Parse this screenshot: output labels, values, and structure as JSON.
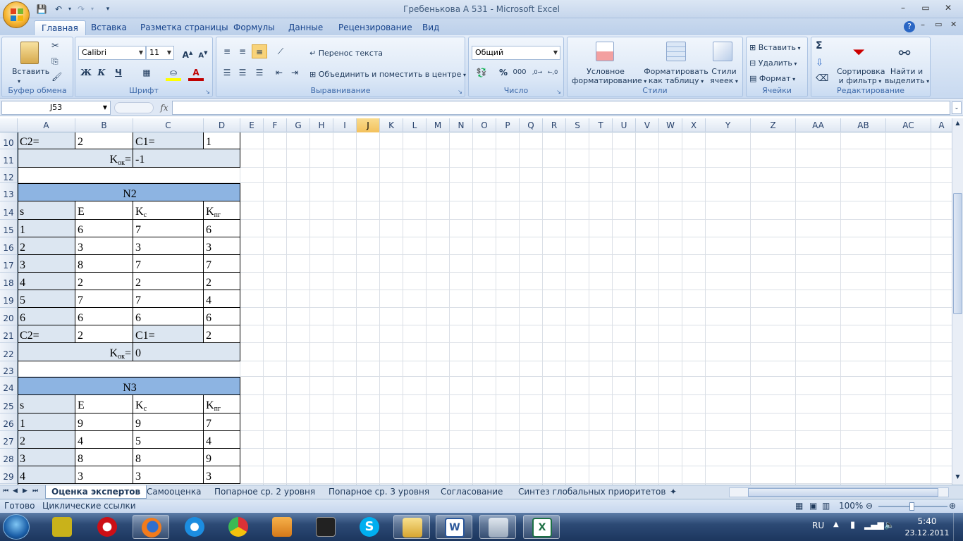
{
  "window": {
    "title": "Гребенькова А 531 - Microsoft Excel"
  },
  "ribbon": {
    "tabs": [
      "Главная",
      "Вставка",
      "Разметка страницы",
      "Формулы",
      "Данные",
      "Рецензирование",
      "Вид"
    ],
    "active_tab": "Главная",
    "clipboard": {
      "paste": "Вставить",
      "label": "Буфер обмена"
    },
    "font": {
      "name": "Calibri",
      "size": "11",
      "bold": "Ж",
      "italic": "К",
      "underline": "Ч",
      "label": "Шрифт"
    },
    "alignment": {
      "wrap": "Перенос текста",
      "merge": "Объединить и поместить в центре",
      "label": "Выравнивание"
    },
    "number": {
      "format": "Общий",
      "label": "Число",
      "percent": "%",
      "thousands": "000"
    },
    "styles": {
      "conditional1": "Условное",
      "conditional2": "форматирование",
      "table1": "Форматировать",
      "table2": "как таблицу",
      "cell1": "Стили",
      "cell2": "ячеек",
      "label": "Стили"
    },
    "cells": {
      "insert": "Вставить",
      "delete": "Удалить",
      "format": "Формат",
      "label": "Ячейки"
    },
    "editing": {
      "sigma": "Σ",
      "sort1": "Сортировка",
      "sort2": "и фильтр",
      "find1": "Найти и",
      "find2": "выделить",
      "label": "Редактирование"
    }
  },
  "formula_bar": {
    "name_box": "J53",
    "fx": "fx",
    "value": ""
  },
  "columns": [
    "A",
    "B",
    "C",
    "D",
    "E",
    "F",
    "G",
    "H",
    "I",
    "J",
    "K",
    "L",
    "M",
    "N",
    "O",
    "P",
    "Q",
    "R",
    "S",
    "T",
    "U",
    "V",
    "W",
    "X",
    "Y",
    "Z",
    "AA",
    "AB",
    "AC",
    "A"
  ],
  "selected_column": "J",
  "rows": {
    "r10": {
      "num": "10",
      "a": "C2=",
      "b": "2",
      "c": "C1=",
      "d": "1"
    },
    "r11": {
      "num": "11",
      "label": "K",
      "sub": "ок",
      "eq": "=",
      "val": "-1"
    },
    "r12": {
      "num": "12"
    },
    "r13": {
      "num": "13",
      "title": "N2"
    },
    "r14": {
      "num": "14",
      "a": "s",
      "b": "E",
      "c": "K",
      "c_sub": "c",
      "d": "K",
      "d_sub": "пг"
    },
    "r15": {
      "num": "15",
      "a": "1",
      "b": "6",
      "c": "7",
      "d": "6"
    },
    "r16": {
      "num": "16",
      "a": "2",
      "b": "3",
      "c": "3",
      "d": "3"
    },
    "r17": {
      "num": "17",
      "a": "3",
      "b": "8",
      "c": "7",
      "d": "7"
    },
    "r18": {
      "num": "18",
      "a": "4",
      "b": "2",
      "c": "2",
      "d": "2"
    },
    "r19": {
      "num": "19",
      "a": "5",
      "b": "7",
      "c": "7",
      "d": "4"
    },
    "r20": {
      "num": "20",
      "a": "6",
      "b": "6",
      "c": "6",
      "d": "6"
    },
    "r21": {
      "num": "21",
      "a": "C2=",
      "b": "2",
      "c": "C1=",
      "d": "2"
    },
    "r22": {
      "num": "22",
      "label": "K",
      "sub": "ок",
      "eq": "=",
      "val": "0"
    },
    "r23": {
      "num": "23"
    },
    "r24": {
      "num": "24",
      "title": "N3"
    },
    "r25": {
      "num": "25",
      "a": "s",
      "b": "E",
      "c": "K",
      "c_sub": "c",
      "d": "K",
      "d_sub": "пг"
    },
    "r26": {
      "num": "26",
      "a": "1",
      "b": "9",
      "c": "9",
      "d": "7"
    },
    "r27": {
      "num": "27",
      "a": "2",
      "b": "4",
      "c": "5",
      "d": "4"
    },
    "r28": {
      "num": "28",
      "a": "3",
      "b": "8",
      "c": "8",
      "d": "9"
    },
    "r29": {
      "num": "29",
      "a": "4",
      "b": "3",
      "c": "3",
      "d": "3"
    }
  },
  "sheets": [
    "Оценка экспертов",
    "Самооценка",
    "Попарное ср. 2 уровня",
    "Попарное ср. 3 уровня",
    "Согласование",
    "Синтез глобальных приоритетов"
  ],
  "active_sheet": "Оценка экспертов",
  "status": {
    "ready": "Готово",
    "circular": "Циклические ссылки",
    "zoom": "100%"
  },
  "taskbar": {
    "lang": "RU",
    "time": "5:40",
    "date": "23.12.2011"
  },
  "colors": {
    "header_blue": "#8db4e2",
    "light_blue": "#dce6f1",
    "selected": "#f3c15c"
  }
}
